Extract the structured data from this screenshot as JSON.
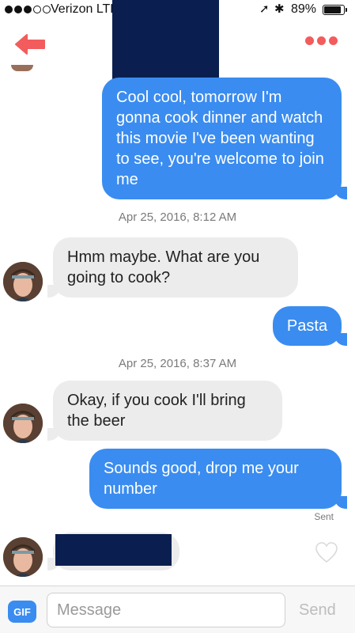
{
  "status_bar": {
    "carrier": "Verizon  LTE",
    "battery_pct": "89%",
    "battery_level": 0.89
  },
  "conversation": [
    {
      "type": "message",
      "direction": "outgoing",
      "text": "Cool cool, tomorrow I'm gonna cook dinner and watch this movie I've been wanting to see, you're welcome to join me"
    },
    {
      "type": "timestamp",
      "text": "Apr 25, 2016, 8:12 AM"
    },
    {
      "type": "message",
      "direction": "incoming",
      "text": "Hmm maybe. What are you going to cook?"
    },
    {
      "type": "message",
      "direction": "outgoing",
      "text": "Pasta"
    },
    {
      "type": "timestamp",
      "text": "Apr 25, 2016, 8:37 AM"
    },
    {
      "type": "message",
      "direction": "incoming",
      "text": "Okay, if you cook I'll bring the beer"
    },
    {
      "type": "message",
      "direction": "outgoing",
      "text": "Sounds good, drop me your number"
    },
    {
      "type": "status",
      "text": "Sent"
    }
  ],
  "composer": {
    "gif_label": "GIF",
    "placeholder": "Message",
    "send_label": "Send"
  },
  "colors": {
    "outgoing_bubble": "#3a8cf0",
    "incoming_bubble": "#ececec",
    "accent_red": "#f25c5c"
  }
}
